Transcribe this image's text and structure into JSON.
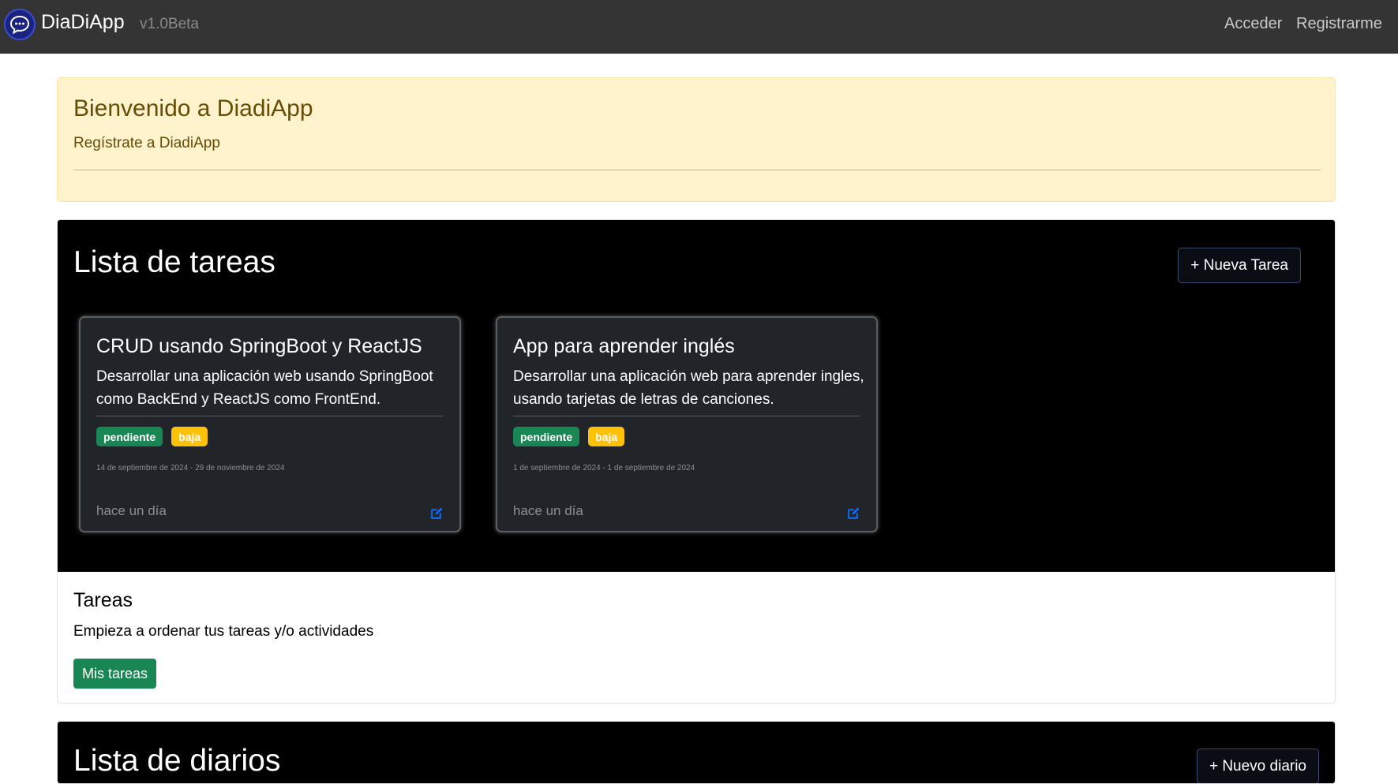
{
  "navbar": {
    "brand": "DiaDiApp",
    "version": "v1.0Beta",
    "logo_icon": "chat-bubble-icon",
    "links": {
      "login": "Acceder",
      "register": "Registrarme"
    }
  },
  "welcome": {
    "title": "Bienvenido a DiadiApp",
    "subtitle": "Regístrate a DiadiApp"
  },
  "tasks_section": {
    "title": "Lista de tareas",
    "new_button": "+ Nueva Tarea",
    "cards": [
      {
        "title": "CRUD usando SpringBoot y ReactJS",
        "description": "Desarrollar una aplicación web usando SpringBoot como BackEnd y ReactJS como FrontEnd.",
        "status": "pendiente",
        "priority": "baja",
        "dates": "14 de septiembre de 2024 - 29 de noviembre de 2024",
        "ago": "hace un día"
      },
      {
        "title": "App para aprender inglés",
        "description": "Desarrollar una aplicación web para aprender ingles, usando tarjetas de letras de canciones.",
        "status": "pendiente",
        "priority": "baja",
        "dates": "1 de septiembre de 2024 - 1 de septiembre de 2024",
        "ago": "hace un día"
      }
    ],
    "info": {
      "title": "Tareas",
      "text": "Empieza a ordenar tus tareas y/o actividades",
      "button": "Mis tareas"
    }
  },
  "diaries_section": {
    "title": "Lista de diarios",
    "new_button": "+ Nuevo diario"
  },
  "colors": {
    "navbar": "#343434",
    "success": "#198754",
    "warning": "#ffc107",
    "card": "#212529",
    "alert": "#fff3cd",
    "edit_icon": "#0d6efd"
  }
}
